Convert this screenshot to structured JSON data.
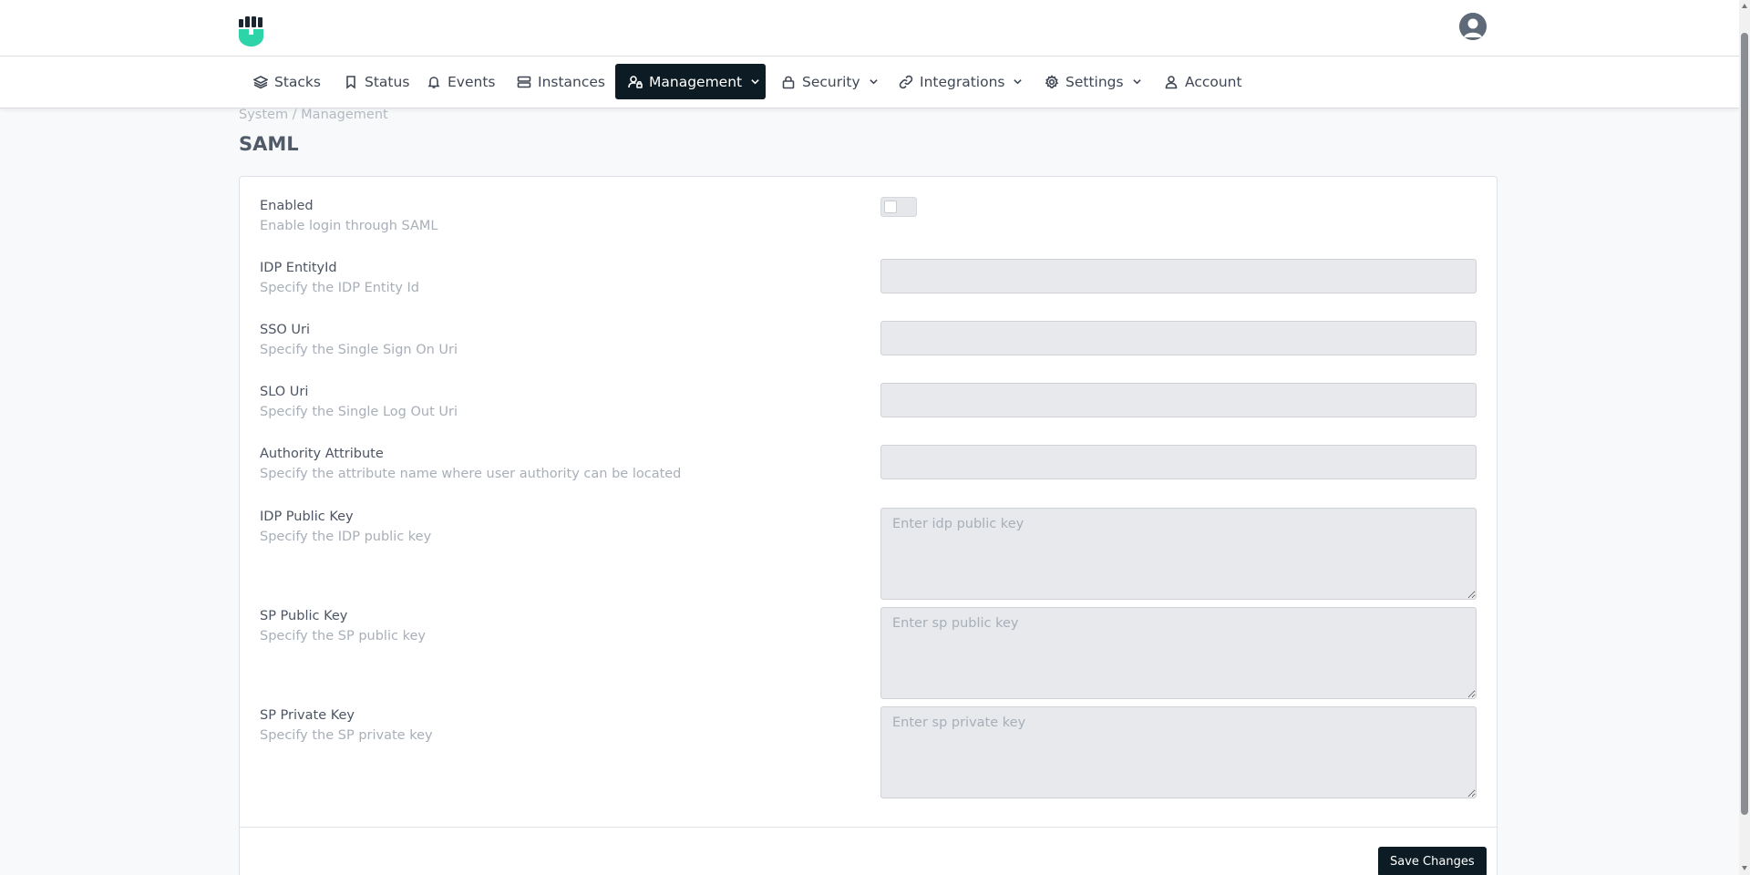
{
  "header": {
    "logo_icon": "fist-logo-icon",
    "avatar_icon": "user-avatar-icon",
    "brand_color": "#2dd4a8"
  },
  "nav": {
    "items": [
      {
        "label": "Stacks",
        "icon": "layers-icon",
        "dropdown": false,
        "active": false
      },
      {
        "label": "Status",
        "icon": "bookmark-icon",
        "dropdown": false,
        "active": false
      },
      {
        "label": "Events",
        "icon": "bell-icon",
        "dropdown": false,
        "active": false
      },
      {
        "label": "Instances",
        "icon": "server-icon",
        "dropdown": false,
        "active": false
      },
      {
        "label": "Management",
        "icon": "user-lock-icon",
        "dropdown": true,
        "active": true
      },
      {
        "label": "Security",
        "icon": "lock-icon",
        "dropdown": true,
        "active": false
      },
      {
        "label": "Integrations",
        "icon": "link-icon",
        "dropdown": true,
        "active": false
      },
      {
        "label": "Settings",
        "icon": "gear-icon",
        "dropdown": true,
        "active": false
      },
      {
        "label": "Account",
        "icon": "user-icon",
        "dropdown": false,
        "active": false
      }
    ],
    "active_color": "#0d1c24"
  },
  "breadcrumb": "System / Management",
  "page_title": "SAML",
  "form": {
    "enabled": {
      "label": "Enabled",
      "description": "Enable login through SAML",
      "value": false
    },
    "idp_entity_id": {
      "label": "IDP EntityId",
      "description": "Specify the IDP Entity Id",
      "value": ""
    },
    "sso_uri": {
      "label": "SSO Uri",
      "description": "Specify the Single Sign On Uri",
      "value": ""
    },
    "slo_uri": {
      "label": "SLO Uri",
      "description": "Specify the Single Log Out Uri",
      "value": ""
    },
    "authority_attribute": {
      "label": "Authority Attribute",
      "description": "Specify the attribute name where user authority can be located",
      "value": ""
    },
    "idp_public_key": {
      "label": "IDP Public Key",
      "description": "Specify the IDP public key",
      "placeholder": "Enter idp public key",
      "value": ""
    },
    "sp_public_key": {
      "label": "SP Public Key",
      "description": "Specify the SP public key",
      "placeholder": "Enter sp public key",
      "value": ""
    },
    "sp_private_key": {
      "label": "SP Private Key",
      "description": "Specify the SP private key",
      "placeholder": "Enter sp private key",
      "value": ""
    },
    "save_label": "Save Changes"
  }
}
